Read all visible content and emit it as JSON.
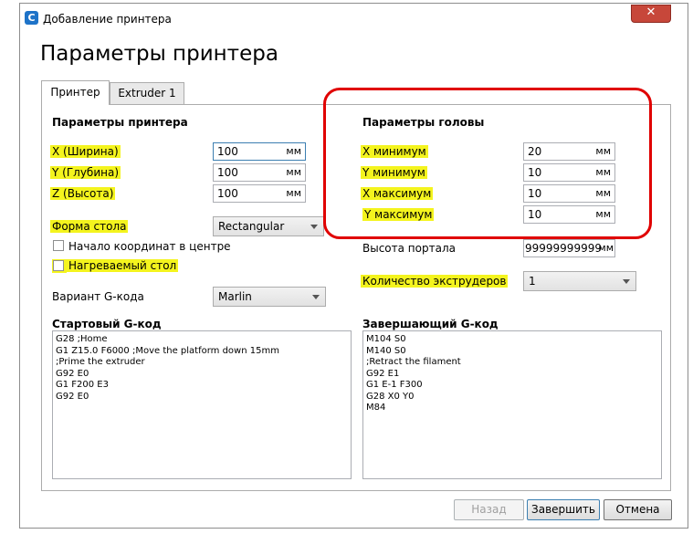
{
  "window": {
    "title": "Добавление принтера",
    "app_icon_letter": "C",
    "close_glyph": "✕"
  },
  "heading": "Параметры принтера",
  "tabs": [
    {
      "label": "Принтер",
      "active": true
    },
    {
      "label": "Extruder 1",
      "active": false
    }
  ],
  "printer_section": {
    "title": "Параметры принтера",
    "fields": [
      {
        "label": "X (Ширина)",
        "value": "100",
        "unit": "мм"
      },
      {
        "label": "Y (Глубина)",
        "value": "100",
        "unit": "мм"
      },
      {
        "label": "Z (Высота)",
        "value": "100",
        "unit": "мм"
      }
    ],
    "bed_shape": {
      "label": "Форма стола",
      "value": "Rectangular"
    },
    "origin_center": {
      "label": "Начало координат в центре",
      "checked": false
    },
    "heated_bed": {
      "label": "Нагреваемый стол",
      "checked": false
    },
    "gcode_flavor": {
      "label": "Вариант G-кода",
      "value": "Marlin"
    }
  },
  "head_section": {
    "title": "Параметры головы",
    "fields": [
      {
        "label": "X минимум",
        "value": "20",
        "unit": "мм"
      },
      {
        "label": "Y минимум",
        "value": "10",
        "unit": "мм"
      },
      {
        "label": "X максимум",
        "value": "10",
        "unit": "мм"
      },
      {
        "label": "Y максимум",
        "value": "10",
        "unit": "мм"
      }
    ],
    "gantry_height": {
      "label": "Высота портала",
      "value": "99999999999",
      "unit": "мм"
    },
    "extruder_count": {
      "label": "Количество экструдеров",
      "value": "1"
    }
  },
  "start_gcode": {
    "title": "Стартовый G-код",
    "text": "G28 ;Home\nG1 Z15.0 F6000 ;Move the platform down 15mm\n;Prime the extruder\nG92 E0\nG1 F200 E3\nG92 E0"
  },
  "end_gcode": {
    "title": "Завершающий G-код",
    "text": "M104 S0\nM140 S0\n;Retract the filament\nG92 E1\nG1 E-1 F300\nG28 X0 Y0\nM84"
  },
  "buttons": {
    "back": "Назад",
    "finish": "Завершить",
    "cancel": "Отмена"
  },
  "colors": {
    "highlight": "#f4f41e",
    "annotation": "#e00000",
    "close_button": "#c7473a"
  }
}
